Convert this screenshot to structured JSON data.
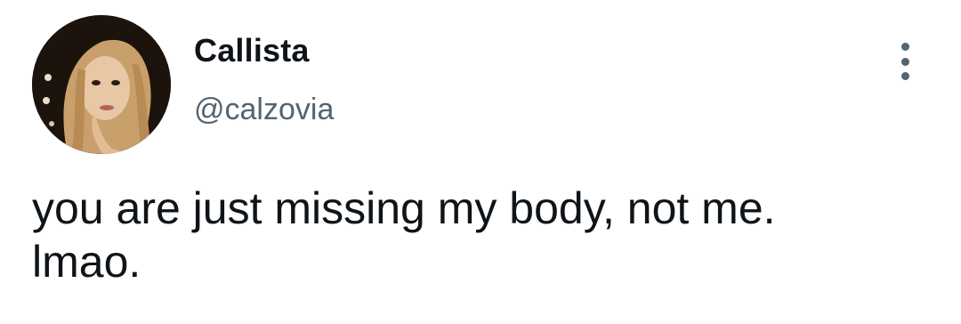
{
  "tweet": {
    "author": {
      "display_name": "Callista",
      "handle": "@calzovia",
      "avatar": "profile-photo"
    },
    "text": "you are just missing my body, not me.\nlmao.",
    "menu_icon": "more-vertical-icon"
  }
}
